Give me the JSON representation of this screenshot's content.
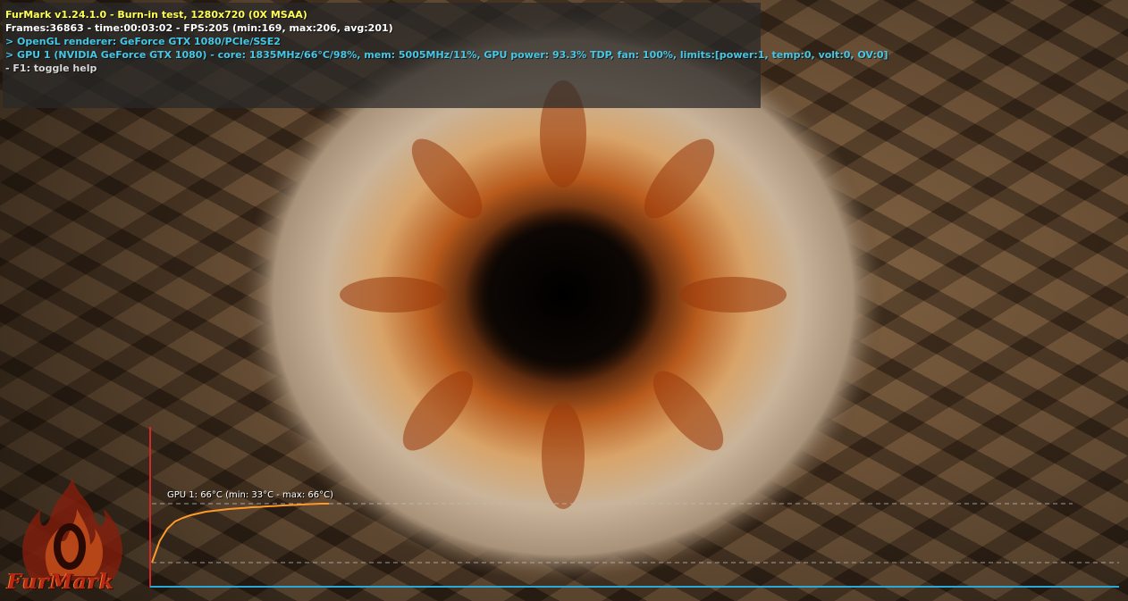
{
  "app": {
    "title_line": "FurMark v1.24.1.0 - Burn-in test, 1280x720 (0X MSAA)",
    "stats_line": "Frames:36863 - time:00:03:02 - FPS:205 (min:169, max:206, avg:201)",
    "renderer_line": "> OpenGL renderer: GeForce GTX 1080/PCIe/SSE2",
    "gpu_line": "> GPU 1 (NVIDIA GeForce GTX 1080) - core: 1835MHz/66°C/98%, mem: 5005MHz/11%, GPU power: 93.3% TDP, fan: 100%, limits:[power:1, temp:0, volt:0, OV:0]",
    "help_line": "- F1: toggle help"
  },
  "logo": {
    "text": "FurMark",
    "icon": "fire-logo-icon"
  },
  "temperature_graph": {
    "label": "GPU 1: 66°C (min: 33°C - max: 66°C)",
    "line_color": "#ff9a2a",
    "axis_color": "#2aa8d8",
    "vertical_axis_color": "#d02a2a",
    "samples": [
      33,
      45,
      52,
      56,
      58,
      59.5,
      60.5,
      61.5,
      62,
      62.5,
      63,
      63.3,
      63.6,
      64,
      64.2,
      64.5,
      64.7,
      65,
      65.2,
      65.4,
      65.6,
      65.8,
      66,
      66
    ],
    "min": 33,
    "max": 66
  }
}
